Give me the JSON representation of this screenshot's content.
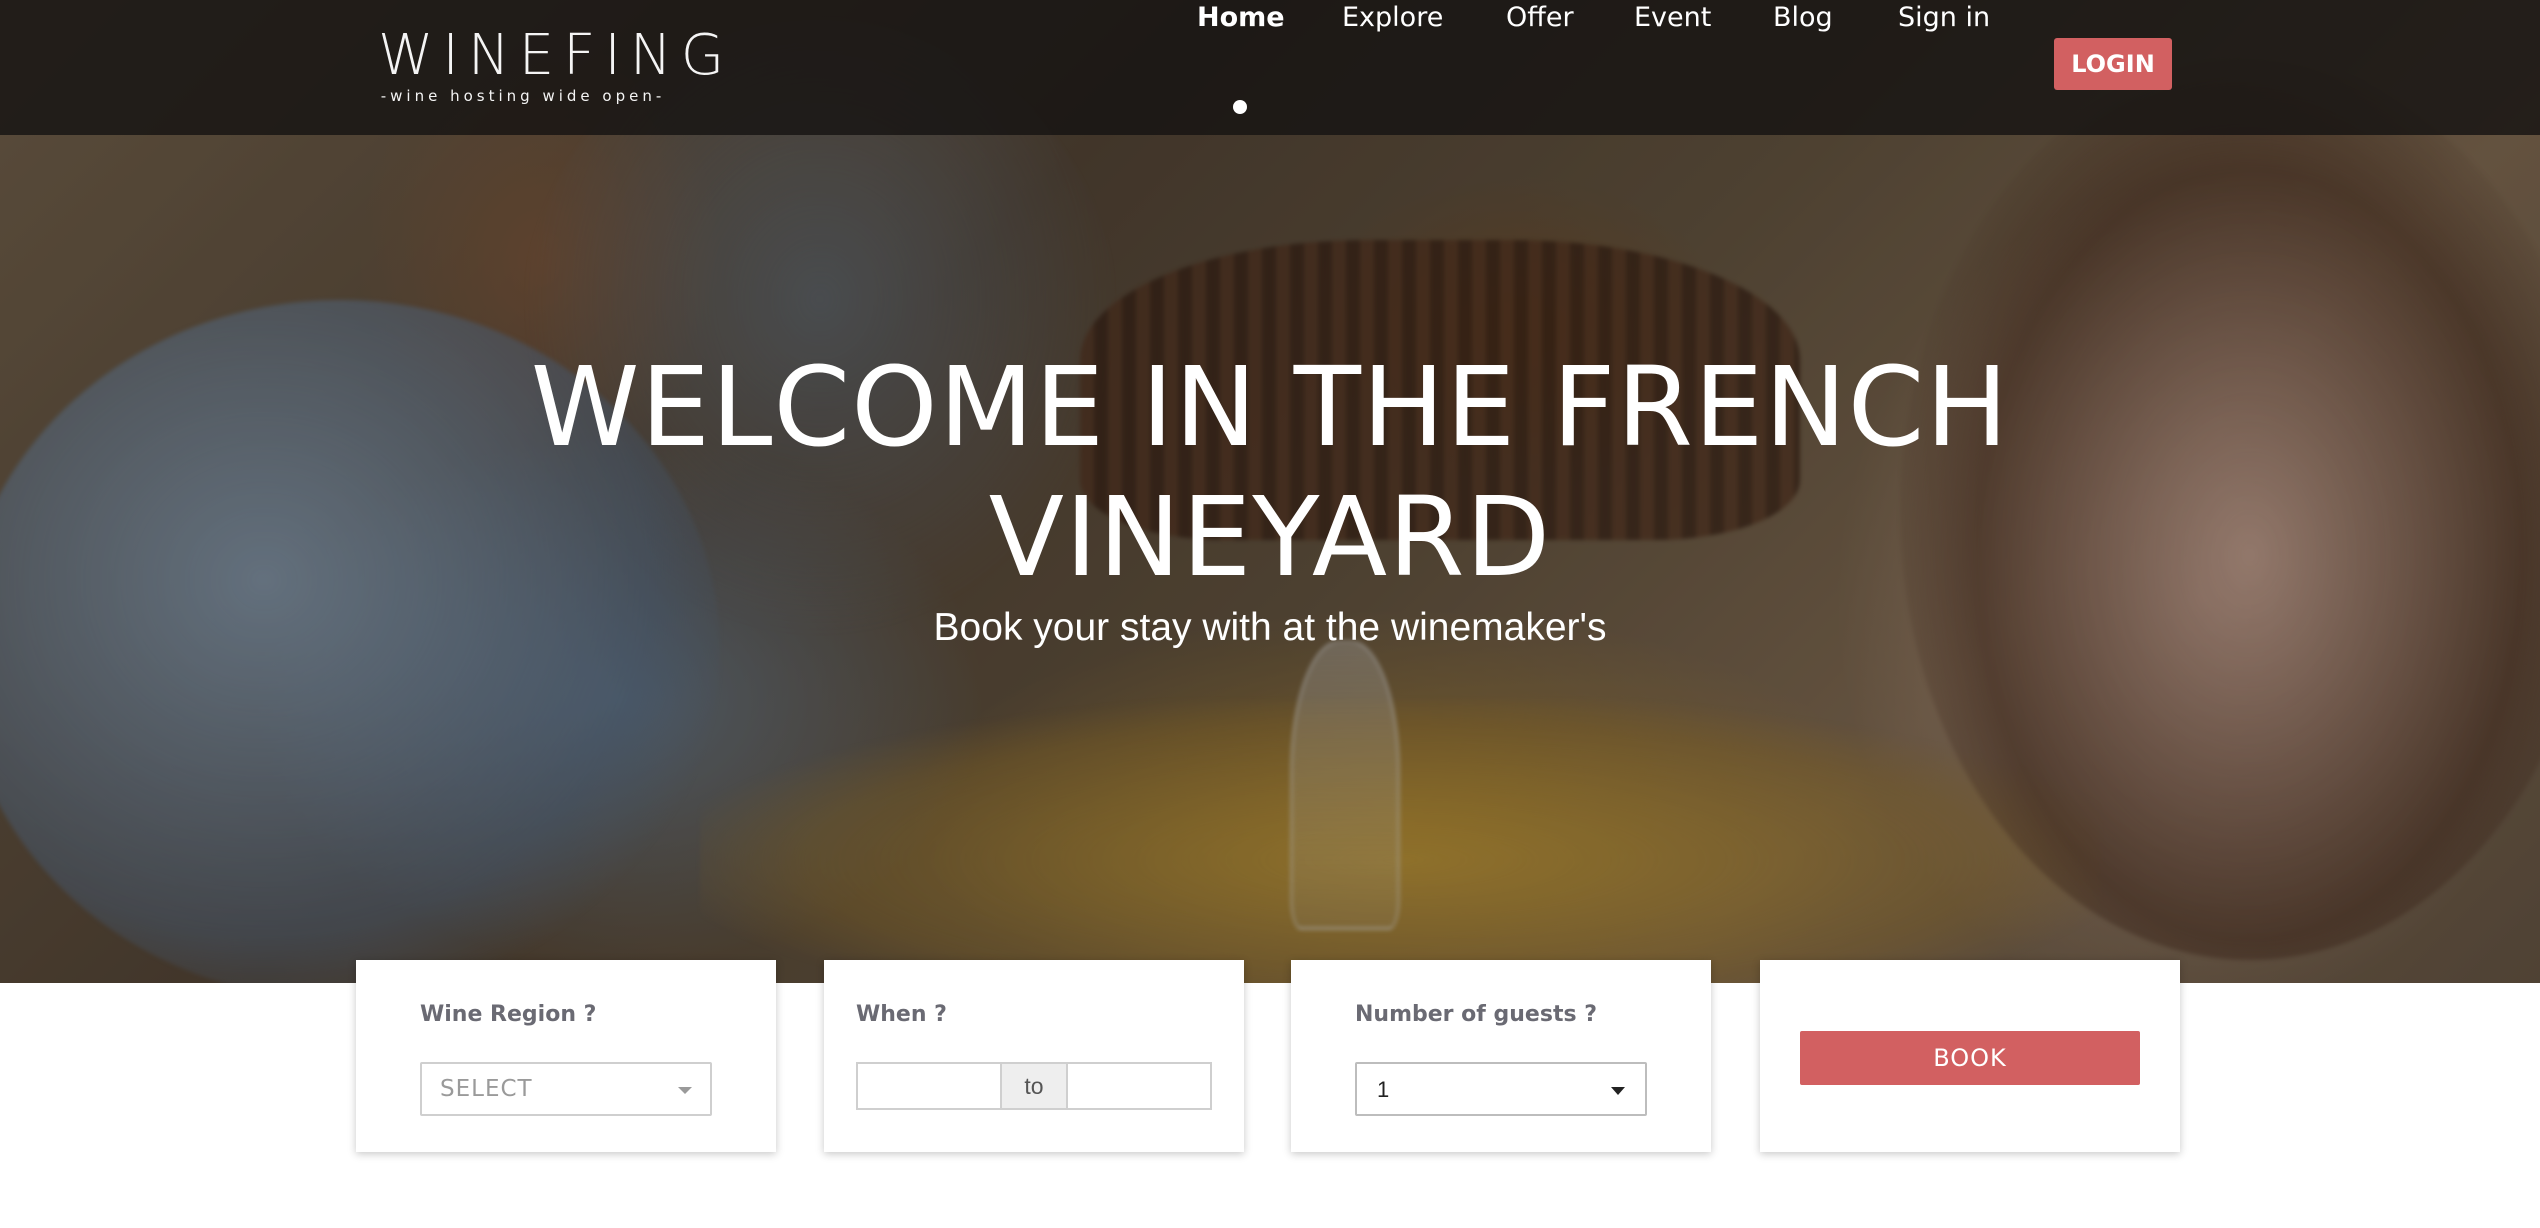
{
  "brand": {
    "name": "WINEFING",
    "tagline": "-wine hosting wide open-"
  },
  "nav": {
    "items": [
      {
        "label": "Home",
        "active": true
      },
      {
        "label": "Explore"
      },
      {
        "label": "Offer"
      },
      {
        "label": "Event"
      },
      {
        "label": "Blog"
      },
      {
        "label": "Sign in"
      }
    ],
    "login_label": "LOGIN"
  },
  "hero": {
    "headline_line1": "WELCOME IN THE FRENCH",
    "headline_line2": "VINEYARD",
    "subheadline": "Book your stay with at the winemaker's"
  },
  "search": {
    "region": {
      "label": "Wine Region ?",
      "value": "SELECT"
    },
    "when": {
      "label": "When ?",
      "separator": "to",
      "from_value": "",
      "to_value": ""
    },
    "guests": {
      "label": "Number of guests ?",
      "value": "1"
    },
    "book_label": "BOOK"
  },
  "colors": {
    "accent": "#d26061",
    "navbar_bg": "#161412",
    "label_text": "#6a6a73"
  }
}
